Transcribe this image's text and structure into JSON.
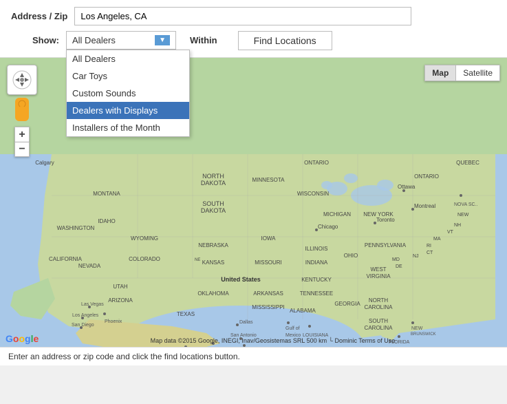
{
  "header": {
    "address_label": "Address / Zip",
    "address_value": "Los Angeles, CA",
    "show_label": "Show:",
    "within_label": "Within",
    "find_btn_label": "Find Locations",
    "dropdown_selected": "All Dealers",
    "dropdown_options": [
      {
        "id": "all-dealers",
        "label": "All Dealers",
        "selected": false
      },
      {
        "id": "car-toys",
        "label": "Car Toys",
        "selected": false
      },
      {
        "id": "custom-sounds",
        "label": "Custom Sounds",
        "selected": false
      },
      {
        "id": "dealers-displays",
        "label": "Dealers with Displays",
        "selected": true
      },
      {
        "id": "installers-month",
        "label": "Installers of the Month",
        "selected": false
      }
    ]
  },
  "map_controls": {
    "zoom_in": "+",
    "zoom_out": "−",
    "map_label": "Map",
    "satellite_label": "Satellite"
  },
  "map_attribution": "Map data ©2015 Google, INEGI, Inav/Geosistemas SRL   500 km └   Dominic   Terms of Use",
  "status_bar": "Enter an address or zip code and click the find locations button."
}
